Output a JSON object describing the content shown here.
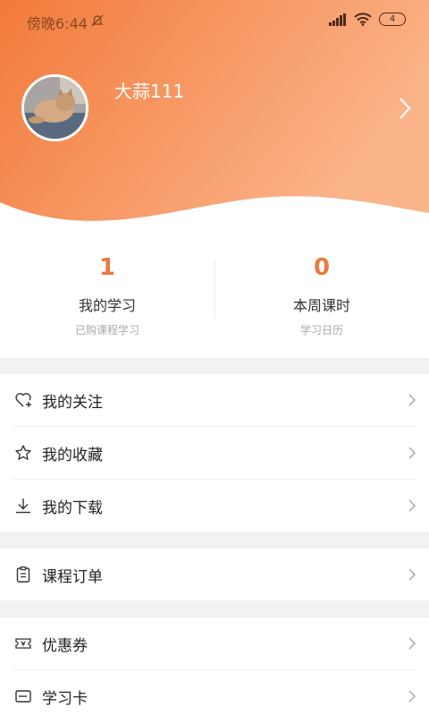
{
  "status_bar": {
    "time": "傍晚6:44",
    "battery": "4"
  },
  "colors": {
    "header_gradient_start": "#f27a3a",
    "header_gradient_end": "#fbb48a",
    "accent": "#ea7a3e",
    "section_gap": "#f2f2f5"
  },
  "profile": {
    "username": "大蒜111",
    "avatar_icon": "cat-avatar"
  },
  "stats": [
    {
      "value": "1",
      "title": "我的学习",
      "subtitle": "已购课程学习"
    },
    {
      "value": "0",
      "title": "本周课时",
      "subtitle": "学习日历"
    }
  ],
  "menu": {
    "follow": {
      "label": "我的关注",
      "icon": "heart-plus-icon"
    },
    "favorites": {
      "label": "我的收藏",
      "icon": "star-icon"
    },
    "downloads": {
      "label": "我的下载",
      "icon": "download-icon"
    },
    "orders": {
      "label": "课程订单",
      "icon": "clipboard-icon"
    },
    "coupons": {
      "label": "优惠券",
      "icon": "ticket-icon"
    },
    "study_card": {
      "label": "学习卡",
      "icon": "card-icon"
    }
  }
}
